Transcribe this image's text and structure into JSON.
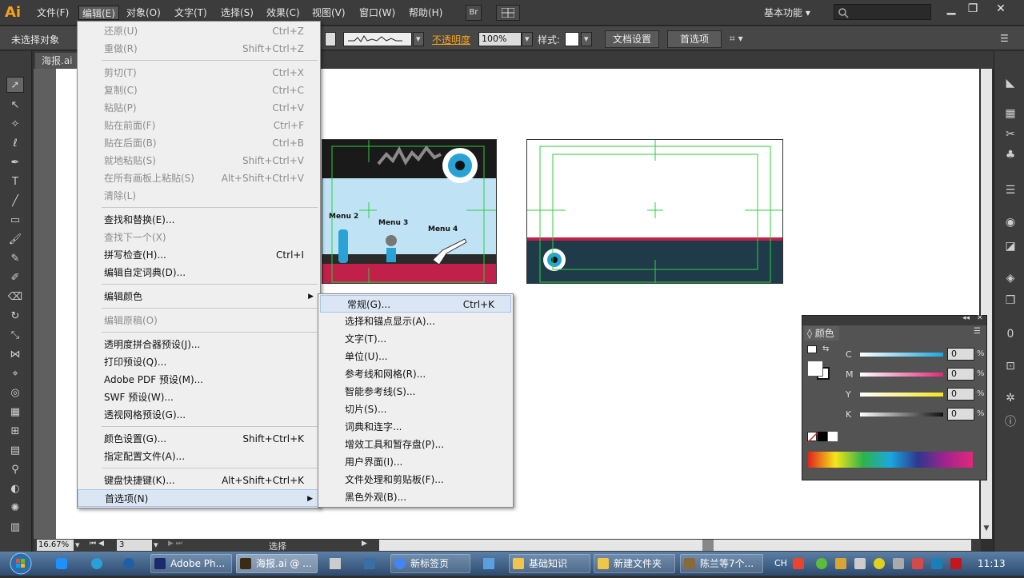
{
  "app": {
    "logo": "Ai"
  },
  "menubar": {
    "items": [
      "文件(F)",
      "编辑(E)",
      "对象(O)",
      "文字(T)",
      "选择(S)",
      "效果(C)",
      "视图(V)",
      "窗口(W)",
      "帮助(H)"
    ],
    "bridge_label": "Br",
    "workspace": "基本功能",
    "workspace_arrow": "▾"
  },
  "controlbar": {
    "selection_status": "未选择对象",
    "opacity_label": "不透明度",
    "opacity_value": "100%",
    "style_label": "样式:",
    "doc_setup_button": "文档设置",
    "prefs_button": "首选项"
  },
  "document": {
    "tab_name": "海报.ai"
  },
  "edit_menu": {
    "items": [
      {
        "label": "还原(U)",
        "shortcut": "Ctrl+Z",
        "disabled": true
      },
      {
        "label": "重做(R)",
        "shortcut": "Shift+Ctrl+Z",
        "disabled": true
      },
      {
        "label": "剪切(T)",
        "shortcut": "Ctrl+X",
        "disabled": true
      },
      {
        "label": "复制(C)",
        "shortcut": "Ctrl+C",
        "disabled": true
      },
      {
        "label": "粘贴(P)",
        "shortcut": "Ctrl+V",
        "disabled": true
      },
      {
        "label": "贴在前面(F)",
        "shortcut": "Ctrl+F",
        "disabled": true
      },
      {
        "label": "贴在后面(B)",
        "shortcut": "Ctrl+B",
        "disabled": true
      },
      {
        "label": "就地粘贴(S)",
        "shortcut": "Shift+Ctrl+V",
        "disabled": true
      },
      {
        "label": "在所有画板上粘贴(S)",
        "shortcut": "Alt+Shift+Ctrl+V",
        "disabled": true
      },
      {
        "label": "清除(L)",
        "shortcut": "",
        "disabled": true
      },
      {
        "label": "查找和替换(E)...",
        "shortcut": "",
        "disabled": false
      },
      {
        "label": "查找下一个(X)",
        "shortcut": "",
        "disabled": true
      },
      {
        "label": "拼写检查(H)...",
        "shortcut": "Ctrl+I",
        "disabled": false
      },
      {
        "label": "编辑自定词典(D)...",
        "shortcut": "",
        "disabled": false
      },
      {
        "label": "编辑颜色",
        "shortcut": "",
        "disabled": false
      },
      {
        "label": "编辑原稿(O)",
        "shortcut": "",
        "disabled": true
      },
      {
        "label": "透明度拼合器预设(J)...",
        "shortcut": "",
        "disabled": false
      },
      {
        "label": "打印预设(Q)...",
        "shortcut": "",
        "disabled": false
      },
      {
        "label": "Adobe PDF 预设(M)...",
        "shortcut": "",
        "disabled": false
      },
      {
        "label": "SWF 预设(W)...",
        "shortcut": "",
        "disabled": false
      },
      {
        "label": "透视网格预设(G)...",
        "shortcut": "",
        "disabled": false
      },
      {
        "label": "颜色设置(G)...",
        "shortcut": "Shift+Ctrl+K",
        "disabled": false
      },
      {
        "label": "指定配置文件(A)...",
        "shortcut": "",
        "disabled": false
      },
      {
        "label": "键盘快捷键(K)...",
        "shortcut": "Alt+Shift+Ctrl+K",
        "disabled": false
      },
      {
        "label": "首选项(N)",
        "shortcut": "",
        "disabled": false
      }
    ],
    "submenu_arrow": "▶"
  },
  "prefs_menu": {
    "items": [
      {
        "label": "常规(G)...",
        "shortcut": "Ctrl+K"
      },
      {
        "label": "选择和锚点显示(A)...",
        "shortcut": ""
      },
      {
        "label": "文字(T)...",
        "shortcut": ""
      },
      {
        "label": "单位(U)...",
        "shortcut": ""
      },
      {
        "label": "参考线和网格(R)...",
        "shortcut": ""
      },
      {
        "label": "智能参考线(S)...",
        "shortcut": ""
      },
      {
        "label": "切片(S)...",
        "shortcut": ""
      },
      {
        "label": "词典和连字...",
        "shortcut": ""
      },
      {
        "label": "增效工具和暂存盘(P)...",
        "shortcut": ""
      },
      {
        "label": "用户界面(I)...",
        "shortcut": ""
      },
      {
        "label": "文件处理和剪贴板(F)...",
        "shortcut": ""
      },
      {
        "label": "黑色外观(B)...",
        "shortcut": ""
      }
    ]
  },
  "artboard1": {
    "labels": [
      "Menu 2",
      "Menu 3",
      "Menu 4"
    ]
  },
  "color_panel": {
    "title": "颜色",
    "channels": [
      {
        "name": "C",
        "value": "0",
        "color": "#1aa7df"
      },
      {
        "name": "M",
        "value": "0",
        "color": "#e0287a"
      },
      {
        "name": "Y",
        "value": "0",
        "color": "#f6e51a"
      },
      {
        "name": "K",
        "value": "0",
        "color": "#111111"
      }
    ],
    "percent": "%"
  },
  "statusbar": {
    "zoom": "16.67%",
    "artboard_number": "3",
    "tool_name": "选择"
  },
  "taskbar": {
    "items": [
      {
        "label": "Adobe Ph...",
        "active": false
      },
      {
        "label": "海报.ai @ ...",
        "active": true
      },
      {
        "label": "新标签页",
        "active": false
      },
      {
        "label": "基础知识",
        "active": false
      },
      {
        "label": "新建文件夹",
        "active": false
      },
      {
        "label": "陈兰等7个...",
        "active": false
      }
    ],
    "lang": "CH",
    "clock": "11:13"
  }
}
